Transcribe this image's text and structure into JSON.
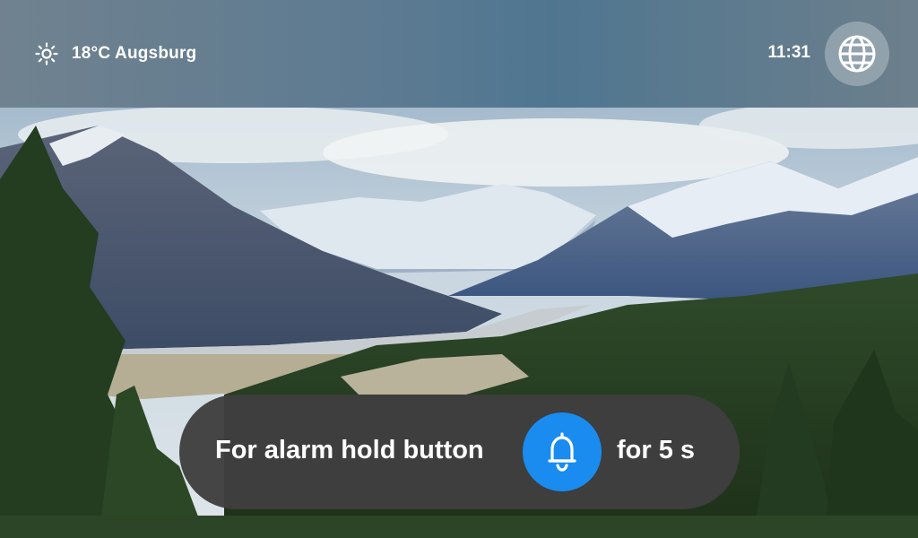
{
  "status_bar": {
    "weather_icon": "sun-icon",
    "weather_text": "18°C Augsburg",
    "time": "11:31",
    "language_icon": "globe-icon"
  },
  "alarm_hint": {
    "text_before": "For alarm hold button",
    "button_icon": "bell-icon",
    "button_color": "#1a8cf0",
    "text_after": "for 5 s"
  },
  "background": {
    "image": "mountain-landscape"
  }
}
